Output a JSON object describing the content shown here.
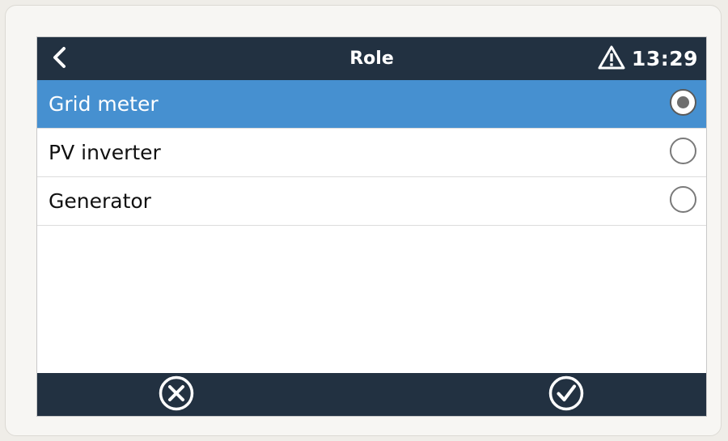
{
  "header": {
    "title": "Role",
    "back_icon": "chevron-left-icon",
    "alert_icon": "warning-triangle-icon",
    "time": "13:29"
  },
  "list": {
    "items": [
      {
        "label": "Grid meter",
        "selected": true
      },
      {
        "label": "PV inverter",
        "selected": false
      },
      {
        "label": "Generator",
        "selected": false
      }
    ]
  },
  "footer": {
    "cancel_icon": "circle-x-icon",
    "confirm_icon": "circle-check-icon"
  },
  "colors": {
    "header_bg": "#223141",
    "selected_row": "#4690d0",
    "text": "#111111"
  }
}
